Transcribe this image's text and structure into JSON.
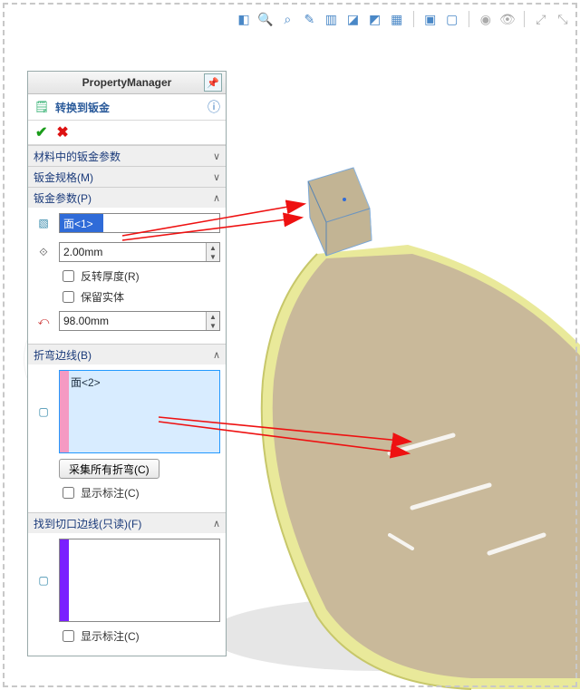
{
  "toolbar_icons": [
    "view-orientation",
    "zoom-to-fit",
    "zoom-area",
    "section-view",
    "appearances",
    "display-style",
    "hide-show",
    "edit-scene",
    "apply-material",
    "view-settings",
    "isometric",
    "camera",
    "eye",
    "expand-a",
    "expand-b"
  ],
  "panel": {
    "title": "PropertyManager",
    "command": "转换到钣金",
    "sections": {
      "s1": {
        "title": "材料中的钣金参数",
        "chev": "∨"
      },
      "s2": {
        "title": "钣金规格(M)",
        "chev": "∨"
      },
      "s3": {
        "title": "钣金参数(P)",
        "chev": "∧",
        "face_sel": "面<1>",
        "thickness": "2.00mm",
        "reverse": "反转厚度(R)",
        "keep": "保留实体",
        "bend_radius": "98.00mm"
      },
      "s4": {
        "title": "折弯边线(B)",
        "chev": "∧",
        "face_sel": "面<2>",
        "collect": "采集所有折弯(C)",
        "show_callouts": "显示标注(C)"
      },
      "s5": {
        "title": "找到切口边线(只读)(F)",
        "chev": "∧",
        "show_callouts": "显示标注(C)"
      }
    }
  },
  "watermark": {
    "l1": "SW",
    "l2": "研习社",
    "l3": "SolidWorks"
  }
}
